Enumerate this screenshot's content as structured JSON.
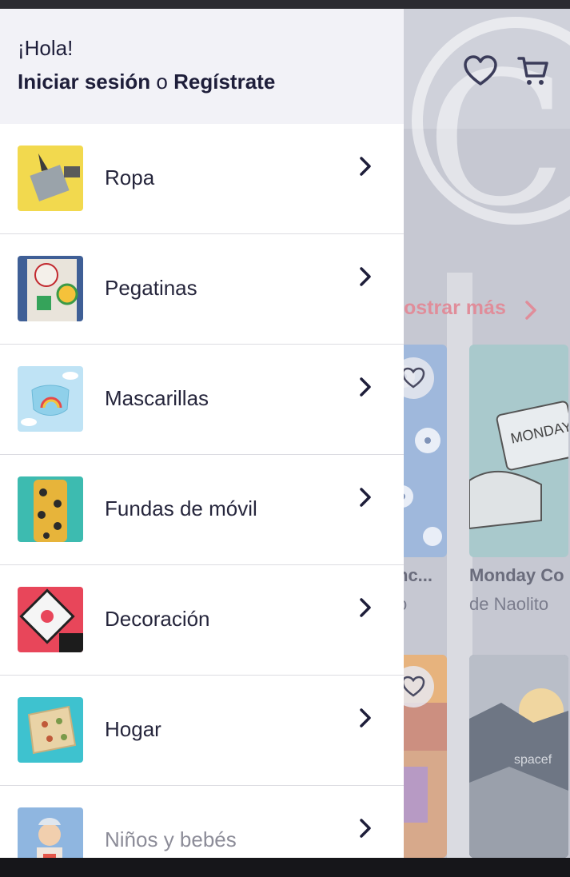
{
  "drawer": {
    "greeting": "¡Hola!",
    "login": "Iniciar sesión",
    "connector": "o",
    "register": "Regístrate",
    "categories": [
      {
        "label": "Ropa",
        "icon": "clothing-thumbnail"
      },
      {
        "label": "Pegatinas",
        "icon": "stickers-thumbnail"
      },
      {
        "label": "Mascarillas",
        "icon": "masks-thumbnail"
      },
      {
        "label": "Fundas de móvil",
        "icon": "phone-cases-thumbnail"
      },
      {
        "label": "Decoración",
        "icon": "decor-thumbnail"
      },
      {
        "label": "Hogar",
        "icon": "home-thumbnail"
      },
      {
        "label": "Niños y bebés",
        "icon": "kids-thumbnail"
      }
    ],
    "chevron_icon": "chevron-right-icon"
  },
  "background": {
    "show_more": "ostrar más",
    "products": [
      {
        "title": "nc...",
        "sub": "o"
      },
      {
        "title": "Monday Co",
        "sub": "de Naolito"
      }
    ],
    "watermark_text": "spacef",
    "header_icons": [
      "heart-icon",
      "cart-icon"
    ]
  },
  "colors": {
    "drawer_header_bg": "#f2f2f7",
    "text_dark": "#1e1e3a",
    "accent_pink": "#e08d9a",
    "overlay": "#c6c8d2"
  }
}
